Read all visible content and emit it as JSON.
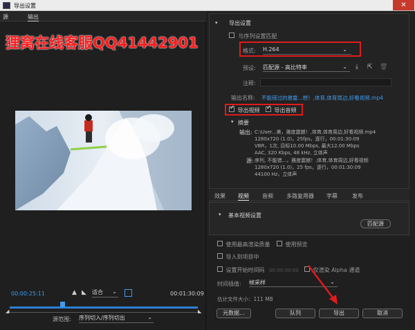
{
  "window": {
    "title": "导出设置",
    "close_symbol": "✕"
  },
  "left_tabs": [
    "源",
    "输出"
  ],
  "watermark": "狸窝在线客服QQ41442901",
  "timeline": {
    "start": "00:00:25:11",
    "end": "00:01:30:09",
    "fit": "适合",
    "range_label": "源范围:",
    "range_value": "序列切入/序列切出",
    "playhead_fraction": 0.28
  },
  "export": {
    "section": "导出设置",
    "match_sequence": "与序列设置匹配",
    "format_label": "格式:",
    "format_value": "H.264",
    "preset_label": "预设:",
    "preset_value": "匹配源 - 高比特率",
    "notes_label": "注释:",
    "output_name_label": "输出名称:",
    "output_name_value": "不能错过的雅雷...想！,体育,体育周边,好看视频.mp4",
    "export_video": "导出视频",
    "export_audio": "导出音频",
    "summary_title": "摘要",
    "summary_output_label": "输出:",
    "summary_output_lines": [
      "C:\\User...美，雅度震撼！,体育,体育周边,好看视频.mp4",
      "1280x720 (1.0)，25fps，逐行，00:01:30:09",
      "VBR，1次, 目标10.00 Mbps, 最大12.00 Mbps",
      "AAC, 320 Kbps, 48 kHz, 立体声"
    ],
    "summary_source_label": "源:",
    "summary_source_lines": [
      "序列, 不能错...，雅度震撼！,体育,体育周边,好看视频",
      "1280x720 (1.0)，25 fps，逐行，00:01:30:09",
      "44100 Hz，立体声"
    ]
  },
  "bottom_tabs": [
    "效果",
    "视频",
    "音频",
    "多路复用器",
    "字幕",
    "发布"
  ],
  "video_settings": {
    "title": "基本视频设置",
    "match_source": "匹配源"
  },
  "options": {
    "max_render": "使用最高渲染质量",
    "use_preview": "使用预览",
    "import_project": "导入到项目中",
    "set_start_tc": "设置开始时间码",
    "start_tc_value": "00:00:00:00",
    "alpha_only": "仅渲染 Alpha 通道",
    "time_interp_label": "时间插值:",
    "time_interp_value": "帧采样",
    "file_size": "估计文件大小：111 MB"
  },
  "buttons": {
    "metadata": "元数据...",
    "queue": "队列",
    "export": "导出",
    "cancel": "取消"
  }
}
